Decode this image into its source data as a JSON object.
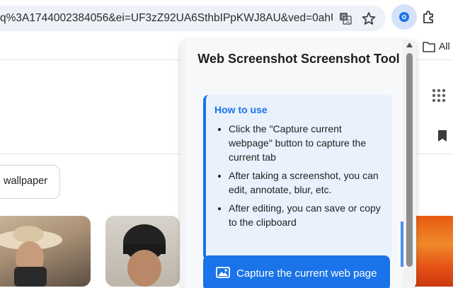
{
  "browser": {
    "url_text": "q%3A1744002384056&ei=UF3zZ92UA6SthbIPpKWJ8AU&ved=0ahU...",
    "bookmarks_label": "All"
  },
  "page": {
    "chip_label": "wallpaper"
  },
  "popup": {
    "title": "Web Screenshot Screenshot Tool",
    "howto_title": "How to use",
    "howto_items": [
      "Click the \"Capture current webpage\" button to capture the current tab",
      "After taking a screenshot, you can edit, annotate, blur, etc.",
      "After editing, you can save or copy to the clipboard"
    ],
    "capture_button_label": "Capture the current web page"
  },
  "colors": {
    "accent": "#1a73e8",
    "howto_bg": "#e8f1fc"
  }
}
